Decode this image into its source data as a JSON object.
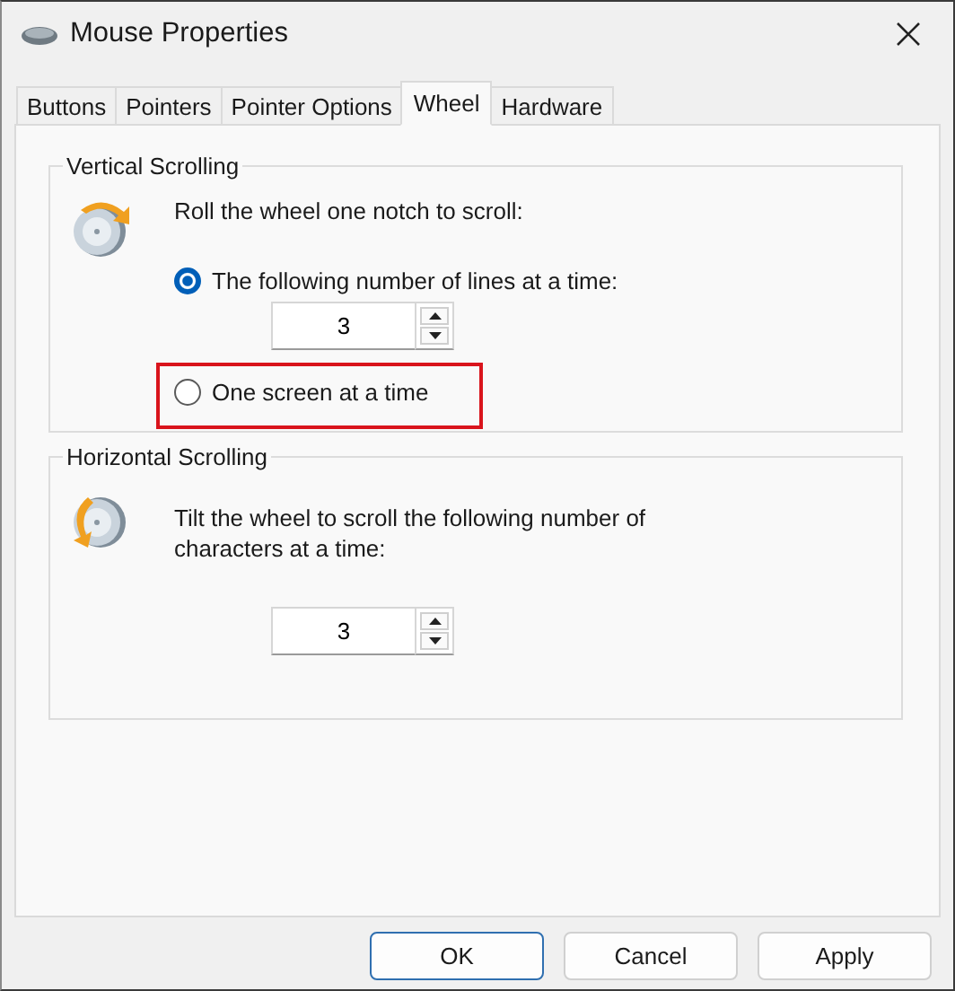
{
  "window": {
    "title": "Mouse Properties"
  },
  "tabs": [
    {
      "label": "Buttons",
      "selected": false
    },
    {
      "label": "Pointers",
      "selected": false
    },
    {
      "label": "Pointer Options",
      "selected": false
    },
    {
      "label": "Wheel",
      "selected": true
    },
    {
      "label": "Hardware",
      "selected": false
    }
  ],
  "vertical_scrolling": {
    "title": "Vertical Scrolling",
    "prompt": "Roll the wheel one notch to scroll:",
    "options": [
      {
        "label": "The following number of lines at a time:",
        "selected": true,
        "highlighted": false,
        "spinner": {
          "value": "3"
        }
      },
      {
        "label": "One screen at a time",
        "selected": false,
        "highlighted": true
      }
    ]
  },
  "horizontal_scrolling": {
    "title": "Horizontal Scrolling",
    "prompt": "Tilt the wheel to scroll the following number of characters at a time:",
    "spinner": {
      "value": "3"
    }
  },
  "buttons": [
    {
      "label": "OK",
      "default": true
    },
    {
      "label": "Cancel",
      "default": false
    },
    {
      "label": "Apply",
      "default": false
    }
  ]
}
